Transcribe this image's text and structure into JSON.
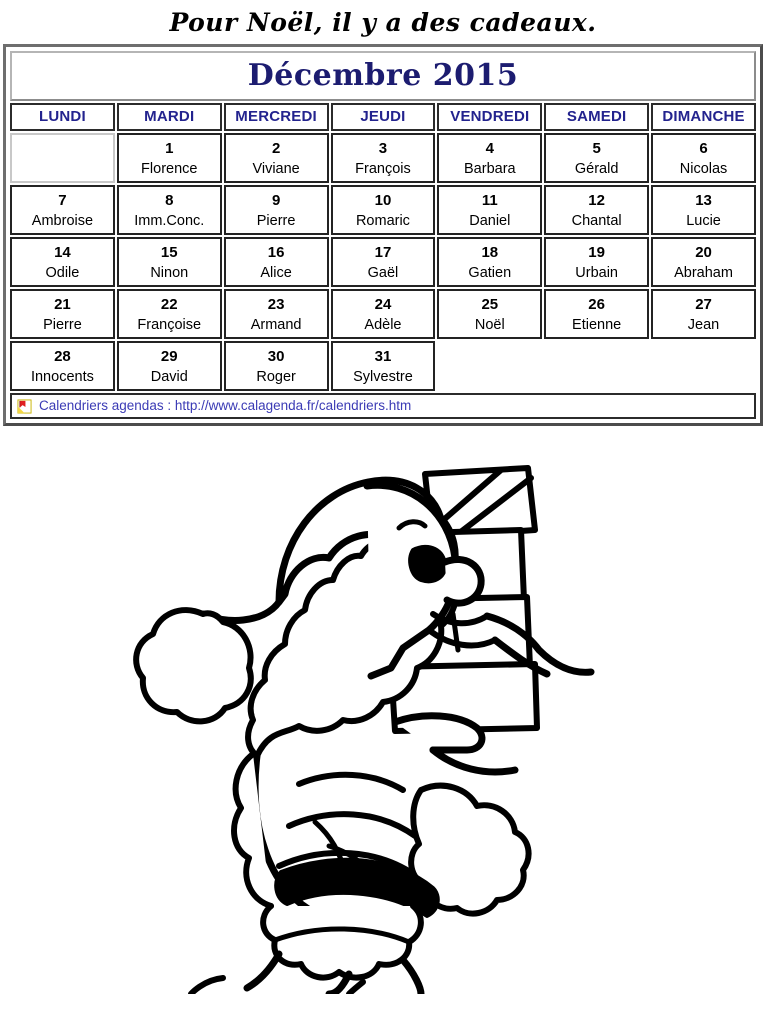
{
  "page": {
    "title": "Pour Noël, il y a des cadeaux."
  },
  "calendar": {
    "month_title": "Décembre 2015",
    "weekdays": [
      "LUNDI",
      "MARDI",
      "MERCREDI",
      "JEUDI",
      "VENDREDI",
      "SAMEDI",
      "DIMANCHE"
    ],
    "weeks": [
      [
        {
          "day": "",
          "saint": "",
          "state": "empty"
        },
        {
          "day": "1",
          "saint": "Florence",
          "state": "day"
        },
        {
          "day": "2",
          "saint": "Viviane",
          "state": "day"
        },
        {
          "day": "3",
          "saint": "François",
          "state": "day"
        },
        {
          "day": "4",
          "saint": "Barbara",
          "state": "day"
        },
        {
          "day": "5",
          "saint": "Gérald",
          "state": "day"
        },
        {
          "day": "6",
          "saint": "Nicolas",
          "state": "day"
        }
      ],
      [
        {
          "day": "7",
          "saint": "Ambroise",
          "state": "day"
        },
        {
          "day": "8",
          "saint": "Imm.Conc.",
          "state": "day"
        },
        {
          "day": "9",
          "saint": "Pierre",
          "state": "day"
        },
        {
          "day": "10",
          "saint": "Romaric",
          "state": "day"
        },
        {
          "day": "11",
          "saint": "Daniel",
          "state": "day"
        },
        {
          "day": "12",
          "saint": "Chantal",
          "state": "day"
        },
        {
          "day": "13",
          "saint": "Lucie",
          "state": "day"
        }
      ],
      [
        {
          "day": "14",
          "saint": "Odile",
          "state": "day"
        },
        {
          "day": "15",
          "saint": "Ninon",
          "state": "day"
        },
        {
          "day": "16",
          "saint": "Alice",
          "state": "day"
        },
        {
          "day": "17",
          "saint": "Gaël",
          "state": "day"
        },
        {
          "day": "18",
          "saint": "Gatien",
          "state": "day"
        },
        {
          "day": "19",
          "saint": "Urbain",
          "state": "day"
        },
        {
          "day": "20",
          "saint": "Abraham",
          "state": "day"
        }
      ],
      [
        {
          "day": "21",
          "saint": "Pierre",
          "state": "day"
        },
        {
          "day": "22",
          "saint": "Françoise",
          "state": "day"
        },
        {
          "day": "23",
          "saint": "Armand",
          "state": "day"
        },
        {
          "day": "24",
          "saint": "Adèle",
          "state": "day"
        },
        {
          "day": "25",
          "saint": "Noël",
          "state": "day"
        },
        {
          "day": "26",
          "saint": "Etienne",
          "state": "day"
        },
        {
          "day": "27",
          "saint": "Jean",
          "state": "day"
        }
      ],
      [
        {
          "day": "28",
          "saint": "Innocents",
          "state": "day"
        },
        {
          "day": "29",
          "saint": "David",
          "state": "day"
        },
        {
          "day": "30",
          "saint": "Roger",
          "state": "day"
        },
        {
          "day": "31",
          "saint": "Sylvestre",
          "state": "day"
        },
        {
          "day": "",
          "saint": "",
          "state": "blank"
        },
        {
          "day": "",
          "saint": "",
          "state": "blank"
        },
        {
          "day": "",
          "saint": "",
          "state": "blank"
        }
      ]
    ],
    "footer": {
      "icon": "flag-bookmark-icon",
      "text": "Calendriers agendas : http://www.calagenda.fr/calendriers.htm"
    }
  },
  "illustration": {
    "name": "santa-claus-with-gift-boxes-line-art",
    "description": "Black and white coloring-page line drawing of Santa Claus carrying a stack of four wrapped gift boxes",
    "stroke_color": "#000000",
    "fill_color": "#ffffff"
  },
  "colors": {
    "month_title": "#1c1c70",
    "weekday_label": "#23238e",
    "footer_link": "#3b3bb5",
    "text": "#000000",
    "background": "#ffffff",
    "cell_border": "#232323",
    "outer_border": "#4c4c4c"
  }
}
